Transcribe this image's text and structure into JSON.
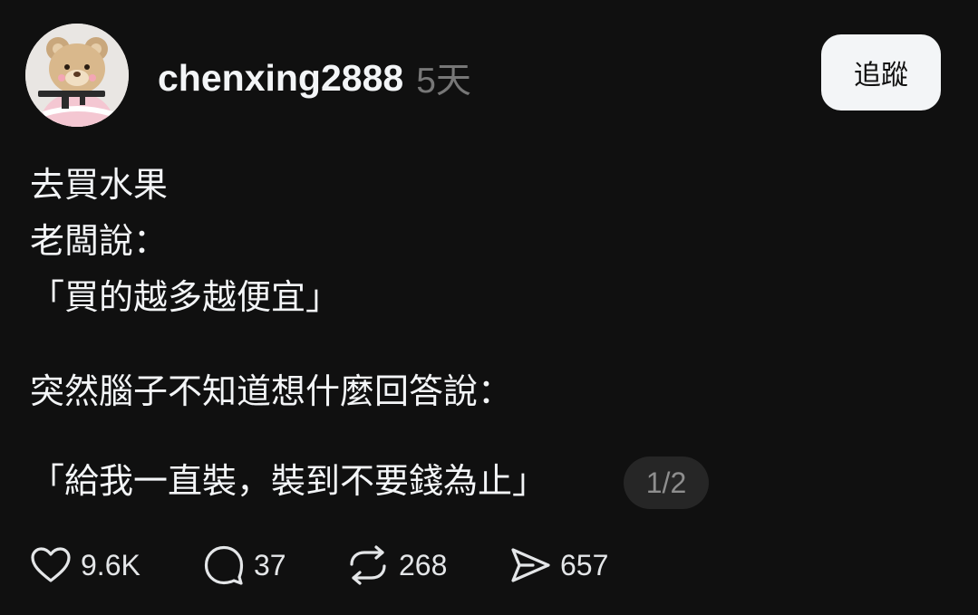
{
  "header": {
    "username": "chenxing2888",
    "timestamp": "5天",
    "follow_label": "追蹤"
  },
  "post": {
    "lines": [
      "去買水果",
      "老闆說：",
      "「買的越多越便宜」",
      "突然腦子不知道想什麼回答說：",
      "「給我一直裝，裝到不要錢為止」"
    ],
    "page_indicator": "1/2"
  },
  "actions": {
    "like_count": "9.6K",
    "comment_count": "37",
    "repost_count": "268",
    "share_count": "657"
  },
  "icons": {
    "like": "heart-icon",
    "comment": "comment-bubble-icon",
    "repost": "repost-icon",
    "share": "send-icon"
  },
  "colors": {
    "background": "#101010",
    "text": "#f3f5f7",
    "muted": "#777777",
    "follow_button_bg": "#f3f5f7"
  }
}
